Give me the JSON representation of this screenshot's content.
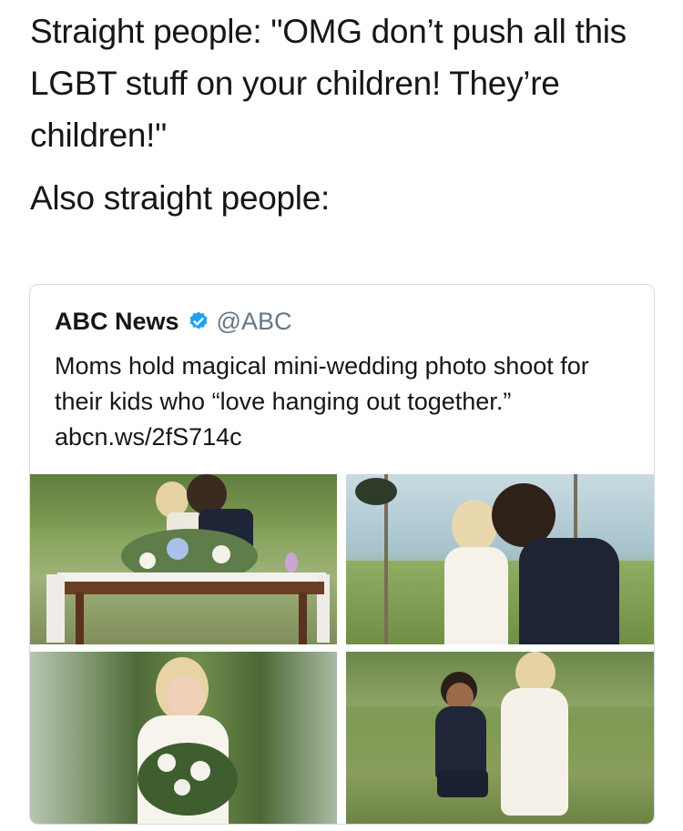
{
  "meme": {
    "caption_1": "Straight people: \"OMG don’t push all this LGBT stuff on your children! They’re children!\"",
    "caption_2": "Also straight people:"
  },
  "quoted_tweet": {
    "author_name": "ABC News",
    "verified_icon": "verified-badge-icon",
    "handle": "@ABC",
    "text": "Moms hold magical mini-wedding photo shoot for their kids who “love hanging out together.” abcn.ws/2fS714c",
    "accent_color": "#1da1f2",
    "photos": [
      {
        "subject": "two children kissing behind a decorated table"
      },
      {
        "subject": "boy kissing girl on the cheek"
      },
      {
        "subject": "girl holding a bouquet"
      },
      {
        "subject": "boy kneeling holding girl's hand"
      }
    ]
  }
}
